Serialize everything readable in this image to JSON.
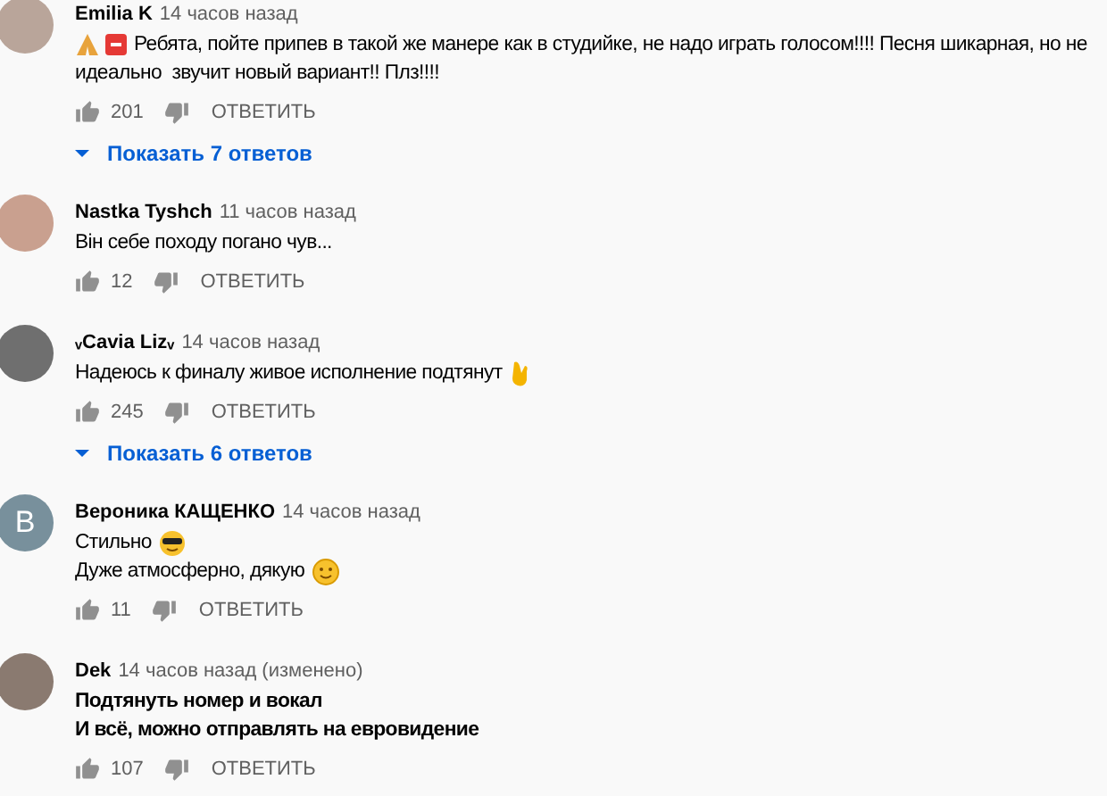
{
  "comments": [
    {
      "author": "Emilia K",
      "time": "14 часов назад",
      "avatar": {
        "kind": "photo"
      },
      "bold": false,
      "lines": [
        {
          "kind": "pray",
          "text": "Ребята, пойте припев в такой же манере как в студийке, не надо играть голосом!!!! Песня шикарная, но не"
        },
        {
          "kind": "plain",
          "text": "идеально  звучит новый вариант!! Плз!!!!"
        }
      ],
      "likes": "201",
      "reply": "ОТВЕТИТЬ",
      "show_replies": "Показать 7 ответов"
    },
    {
      "author": "Nastka Tyshch",
      "time": "11 часов назад",
      "avatar": {
        "kind": "photo"
      },
      "bold": false,
      "lines": [
        {
          "kind": "plain",
          "text": "Він себе походу погано чув..."
        }
      ],
      "likes": "12",
      "reply": "ОТВЕТИТЬ"
    },
    {
      "author": "ᵥCavia Lizᵥ",
      "time": "14 часов назад",
      "avatar": {
        "kind": "photo"
      },
      "bold": false,
      "lines": [
        {
          "kind": "fingers",
          "text": "Надеюсь к финалу живое исполнение подтянут"
        }
      ],
      "likes": "245",
      "reply": "ОТВЕТИТЬ",
      "show_replies": "Показать 6 ответов"
    },
    {
      "author": "Вероника КАЩЕНКО",
      "time": "14 часов назад",
      "avatar": {
        "kind": "letter",
        "letter": "B",
        "color": "#78909c"
      },
      "bold": false,
      "lines": [
        {
          "kind": "cool",
          "text": "Стильно"
        },
        {
          "kind": "smile",
          "text": "Дуже атмосферно, дякую"
        }
      ],
      "likes": "11",
      "reply": "ОТВЕТИТЬ"
    },
    {
      "author": "Dek",
      "time": "14 часов назад (изменено)",
      "avatar": {
        "kind": "photo"
      },
      "bold": true,
      "lines": [
        {
          "kind": "plain",
          "text": "Подтянуть номер и вокал"
        },
        {
          "kind": "plain",
          "text": "И всё, можно отправлять на евровидение"
        }
      ],
      "likes": "107",
      "reply": "ОТВЕТИТЬ"
    }
  ]
}
